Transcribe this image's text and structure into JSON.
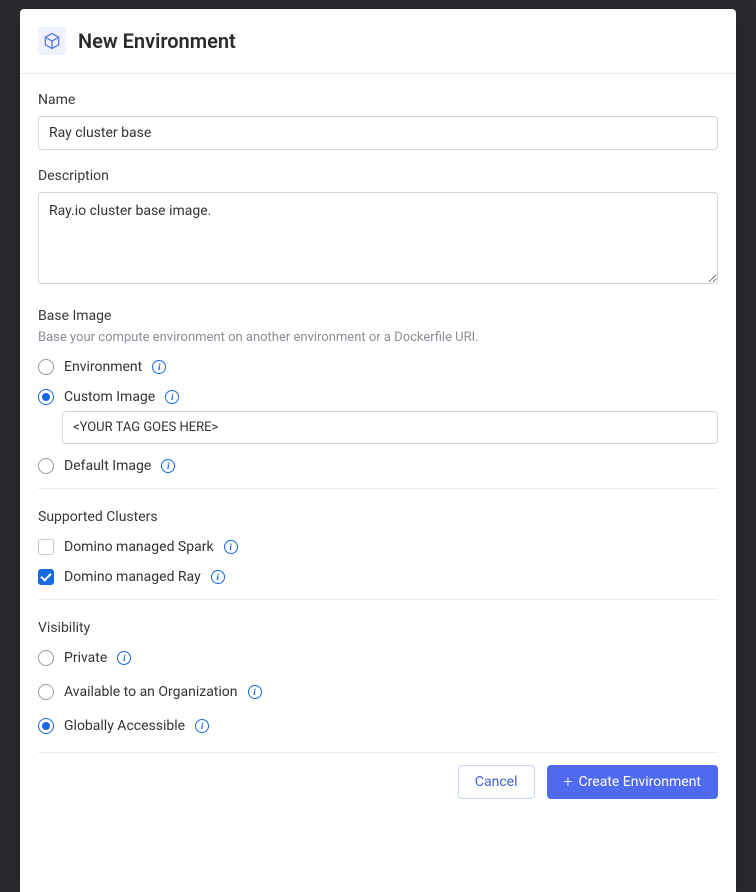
{
  "modal": {
    "title": "New Environment"
  },
  "fields": {
    "name": {
      "label": "Name",
      "value": "Ray cluster base"
    },
    "description": {
      "label": "Description",
      "value": "Ray.io cluster base image."
    }
  },
  "baseImage": {
    "label": "Base Image",
    "help": "Base your compute environment on another environment or a Dockerfile URI.",
    "options": {
      "environment": "Environment",
      "custom": "Custom Image",
      "default": "Default Image"
    },
    "customValue": "<YOUR TAG GOES HERE>"
  },
  "clusters": {
    "label": "Supported Clusters",
    "options": {
      "spark": "Domino managed Spark",
      "ray": "Domino managed Ray"
    }
  },
  "visibility": {
    "label": "Visibility",
    "options": {
      "private": "Private",
      "org": "Available to an Organization",
      "global": "Globally Accessible"
    }
  },
  "buttons": {
    "cancel": "Cancel",
    "create": "Create Environment"
  }
}
